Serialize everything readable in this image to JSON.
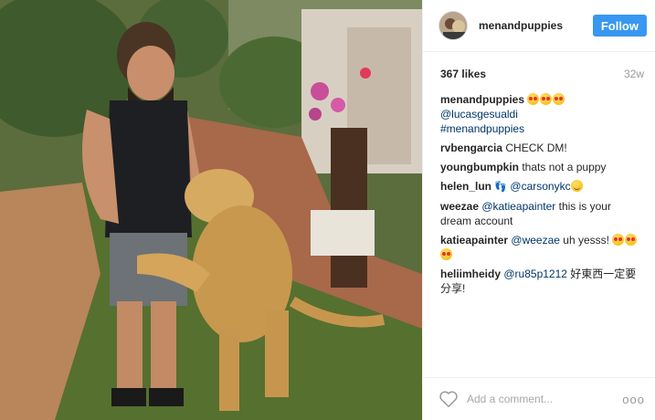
{
  "post": {
    "username": "menandpuppies",
    "follow_label": "Follow",
    "likes": "367 likes",
    "age": "32w"
  },
  "comments": [
    {
      "user": "menandpuppies",
      "emojis_before": [
        "heart-eyes-emoji",
        "heart-eyes-emoji",
        "heart-eyes-emoji"
      ],
      "mention": "@lucasgesualdi",
      "hashtag": "#menandpuppies"
    },
    {
      "user": "rvbengarcia",
      "text": "CHECK DM!"
    },
    {
      "user": "youngbumpkin",
      "text": "thats not a puppy"
    },
    {
      "user": "helen_lun",
      "mention": "@carsonykc"
    },
    {
      "user": "weezae",
      "mention": "@katieapainter",
      "text": "this is your dream account"
    },
    {
      "user": "katieapainter",
      "mention": "@weezae",
      "text": "uh yesss!"
    },
    {
      "user": "heliimheidy",
      "mention": "@ru85p1212",
      "text": "好東西一定要分享!"
    }
  ],
  "footer": {
    "add_comment_placeholder": "Add a comment...",
    "more_label": "ooo"
  },
  "colors": {
    "follow_button": "#3897f0",
    "link": "#003569"
  }
}
